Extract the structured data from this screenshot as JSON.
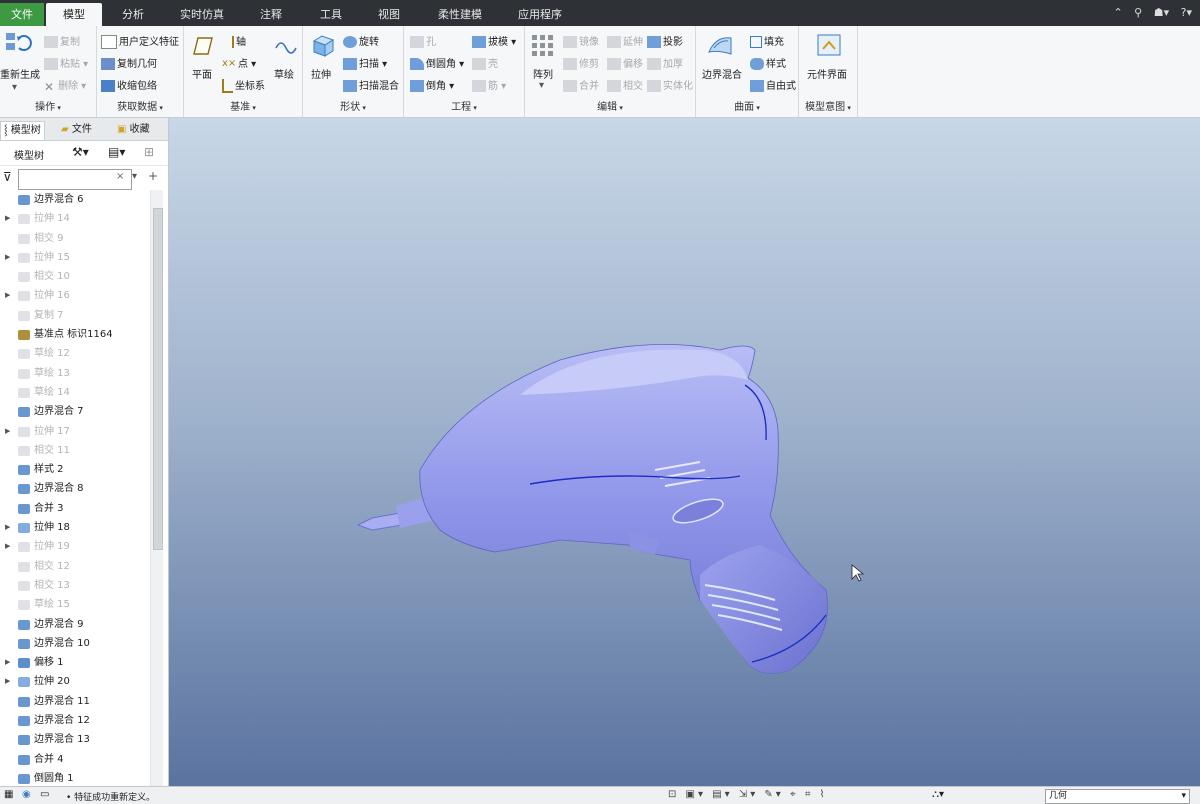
{
  "tabs": [
    {
      "label": "文件",
      "kind": "file"
    },
    {
      "label": "模型",
      "kind": "active"
    },
    {
      "label": "分析",
      "kind": ""
    },
    {
      "label": "实时仿真",
      "kind": ""
    },
    {
      "label": "注释",
      "kind": ""
    },
    {
      "label": "工具",
      "kind": ""
    },
    {
      "label": "视图",
      "kind": ""
    },
    {
      "label": "柔性建模",
      "kind": ""
    },
    {
      "label": "应用程序",
      "kind": ""
    }
  ],
  "ribbon": {
    "operations": {
      "label": "操作",
      "regenerate": "重新生成",
      "copy": "复制",
      "paste": "粘贴",
      "delete": "删除"
    },
    "get_data": {
      "label": "获取数据",
      "udf": "用户定义特征",
      "copy_geom": "复制几何",
      "shrinkwrap": "收缩包络"
    },
    "datum": {
      "label": "基准",
      "plane": "平面",
      "axis": "轴",
      "point": "点",
      "csys": "坐标系",
      "sketch": "草绘"
    },
    "shapes": {
      "label": "形状",
      "extrude": "拉伸",
      "revolve": "旋转",
      "sweep": "扫描",
      "swept_blend": "扫描混合"
    },
    "engineering": {
      "label": "工程",
      "hole": "孔",
      "draft": "拔模",
      "round": "倒圆角",
      "shell": "壳",
      "chamfer": "倒角",
      "rib": "筋"
    },
    "editing": {
      "label": "编辑",
      "pattern": "阵列",
      "mirror": "镜像",
      "extend": "延伸",
      "project": "投影",
      "trim": "修剪",
      "offset": "偏移",
      "thicken": "加厚",
      "merge": "合并",
      "intersect": "相交",
      "solidify": "实体化"
    },
    "surfaces": {
      "label": "曲面",
      "boundary_blend": "边界混合",
      "fill": "填充",
      "style": "样式",
      "freestyle": "自由式"
    },
    "model_intent": {
      "label": "模型意图",
      "component_interface": "元件界面"
    }
  },
  "left_panel": {
    "tabs": [
      "模型树",
      "文件",
      "收藏"
    ],
    "tree_title": "模型树",
    "filter_placeholder": "",
    "items": [
      {
        "label": "边界混合 6",
        "icon": "boundary-blend",
        "dim": false,
        "expandable": false
      },
      {
        "label": "拉伸 14",
        "icon": "extrude",
        "dim": true,
        "expandable": true
      },
      {
        "label": "相交 9",
        "icon": "intersect",
        "dim": true,
        "expandable": false
      },
      {
        "label": "拉伸 15",
        "icon": "extrude",
        "dim": true,
        "expandable": true
      },
      {
        "label": "相交 10",
        "icon": "intersect",
        "dim": true,
        "expandable": false
      },
      {
        "label": "拉伸 16",
        "icon": "extrude",
        "dim": true,
        "expandable": true
      },
      {
        "label": "复制 7",
        "icon": "copy",
        "dim": true,
        "expandable": false
      },
      {
        "label": "基准点 标识1164",
        "icon": "datum-point",
        "dim": false,
        "expandable": false
      },
      {
        "label": "草绘 12",
        "icon": "sketch",
        "dim": true,
        "expandable": false
      },
      {
        "label": "草绘 13",
        "icon": "sketch",
        "dim": true,
        "expandable": false
      },
      {
        "label": "草绘 14",
        "icon": "sketch",
        "dim": true,
        "expandable": false
      },
      {
        "label": "边界混合 7",
        "icon": "boundary-blend",
        "dim": false,
        "expandable": false
      },
      {
        "label": "拉伸 17",
        "icon": "extrude",
        "dim": true,
        "expandable": true
      },
      {
        "label": "相交 11",
        "icon": "intersect",
        "dim": true,
        "expandable": false
      },
      {
        "label": "样式 2",
        "icon": "style",
        "dim": false,
        "expandable": false
      },
      {
        "label": "边界混合 8",
        "icon": "boundary-blend",
        "dim": false,
        "expandable": false
      },
      {
        "label": "合并 3",
        "icon": "merge",
        "dim": false,
        "expandable": false
      },
      {
        "label": "拉伸 18",
        "icon": "extrude",
        "dim": false,
        "expandable": true
      },
      {
        "label": "拉伸 19",
        "icon": "extrude",
        "dim": true,
        "expandable": true
      },
      {
        "label": "相交 12",
        "icon": "intersect",
        "dim": true,
        "expandable": false
      },
      {
        "label": "相交 13",
        "icon": "intersect",
        "dim": true,
        "expandable": false
      },
      {
        "label": "草绘 15",
        "icon": "sketch",
        "dim": true,
        "expandable": false
      },
      {
        "label": "边界混合 9",
        "icon": "boundary-blend",
        "dim": false,
        "expandable": false
      },
      {
        "label": "边界混合 10",
        "icon": "boundary-blend",
        "dim": false,
        "expandable": false
      },
      {
        "label": "偏移 1",
        "icon": "offset",
        "dim": false,
        "expandable": true
      },
      {
        "label": "拉伸 20",
        "icon": "extrude",
        "dim": false,
        "expandable": true
      },
      {
        "label": "边界混合 11",
        "icon": "boundary-blend",
        "dim": false,
        "expandable": false
      },
      {
        "label": "边界混合 12",
        "icon": "boundary-blend",
        "dim": false,
        "expandable": false
      },
      {
        "label": "边界混合 13",
        "icon": "boundary-blend",
        "dim": false,
        "expandable": false
      },
      {
        "label": "合并 4",
        "icon": "merge",
        "dim": false,
        "expandable": false
      },
      {
        "label": "倒圆角 1",
        "icon": "round",
        "dim": false,
        "expandable": false
      }
    ]
  },
  "status": {
    "message": "• 特征成功重新定义。",
    "filter_value": "几何"
  },
  "colors": {
    "accent_green": "#3d9a43",
    "model_fill": "#8f95e8",
    "curve": "#1b2fc4"
  }
}
